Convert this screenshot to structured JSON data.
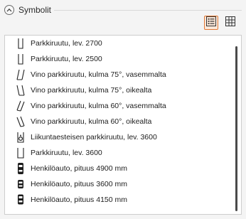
{
  "panel": {
    "title": "Symbolit"
  },
  "view_toggle": {
    "list_icon": "list-view-icon",
    "grid_icon": "grid-view-icon",
    "active": "list",
    "accent_color": "#e27a37"
  },
  "symbols": [
    {
      "label": "Parkkiruutu, lev. 2700",
      "icon": "parking-straight-icon"
    },
    {
      "label": "Parkkiruutu, lev. 2500",
      "icon": "parking-straight-icon"
    },
    {
      "label": "Vino parkkiruutu, kulma 75°, vasemmalta",
      "icon": "parking-angled-left-icon"
    },
    {
      "label": "Vino parkkiruutu, kulma 75°, oikealta",
      "icon": "parking-angled-right-icon"
    },
    {
      "label": "Vino parkkiruutu, kulma 60°, vasemmalta",
      "icon": "parking-angled-left-icon"
    },
    {
      "label": "Vino parkkiruutu, kulma 60°, oikealta",
      "icon": "parking-angled-right-icon"
    },
    {
      "label": "Liikuntaesteisen parkkiruutu, lev. 3600",
      "icon": "accessible-parking-icon"
    },
    {
      "label": "Parkkiruutu, lev. 3600",
      "icon": "parking-straight-icon"
    },
    {
      "label": "Henkilöauto, pituus 4900 mm",
      "icon": "car-icon"
    },
    {
      "label": "Henkilöauto, pituus 3600 mm",
      "icon": "car-icon"
    },
    {
      "label": "Henkilöauto, pituus 4150 mm",
      "icon": "car-icon"
    }
  ]
}
